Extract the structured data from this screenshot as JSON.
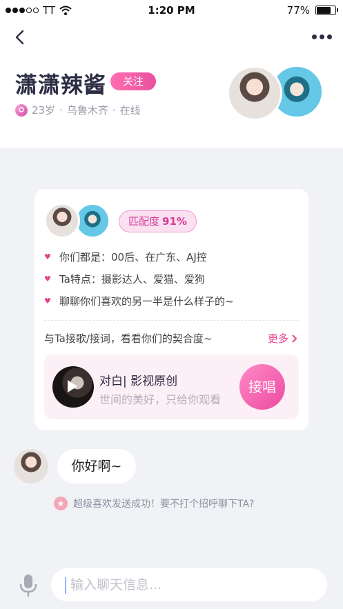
{
  "status_bar": {
    "carrier": "TT",
    "time": "1:20 PM",
    "battery": "77%",
    "battery_level": 0.77
  },
  "header": {
    "back_icon": "chevron-left-icon",
    "more_icon": "more-horizontal-icon",
    "name": "潇潇辣酱",
    "follow_label": "关注",
    "age": "23岁",
    "location": "乌鲁木齐",
    "status": "在线",
    "separator": "·"
  },
  "match_card": {
    "match_label": "匹配度",
    "match_value": "91%",
    "traits": [
      "你们都是：00后、在广东、AJ控",
      "Ta特点：摄影达人、爱猫、爱狗",
      "聊聊你们喜欢的另一半是什么样子的~"
    ],
    "prompt": "与Ta接歌/接词，看看你们的契合度~",
    "more_label": "更多",
    "song_title": "对白| 影视原创",
    "song_subtitle": "世间的美好，只给你观看",
    "sing_label": "接唱"
  },
  "chat": {
    "message": "你好啊~",
    "notice": "超级喜欢发送成功！要不打个招呼聊下TA?"
  },
  "input": {
    "placeholder": "输入聊天信息..."
  },
  "colors": {
    "accent": "#e8428c",
    "title": "#2c2c44",
    "background": "#f1f2f6"
  }
}
